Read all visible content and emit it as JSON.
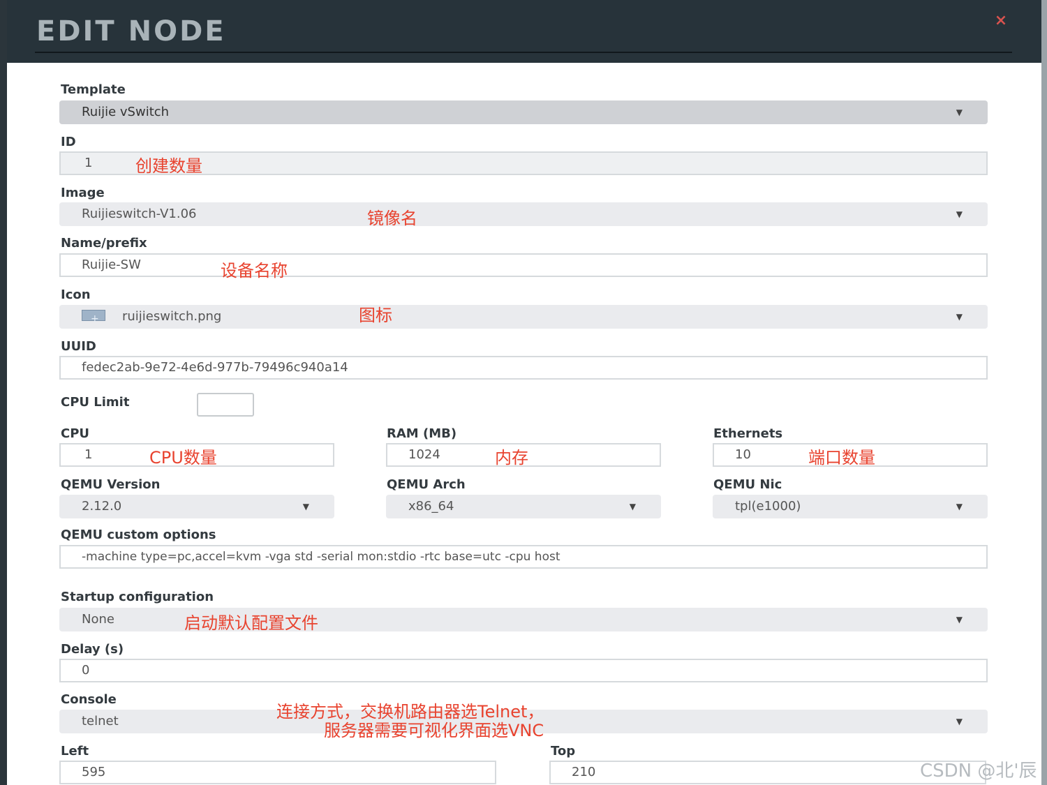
{
  "dialog": {
    "title": "EDIT NODE",
    "close_glyph": "×"
  },
  "form": {
    "template": {
      "label": "Template",
      "value": "Ruijie vSwitch"
    },
    "id": {
      "label": "ID",
      "value": "1"
    },
    "image": {
      "label": "Image",
      "value": "Ruijieswitch-V1.06"
    },
    "name": {
      "label": "Name/prefix",
      "value": "Ruijie-SW"
    },
    "icon": {
      "label": "Icon",
      "value": "ruijieswitch.png",
      "icon_name": "image-file-icon"
    },
    "uuid": {
      "label": "UUID",
      "value": "fedec2ab-9e72-4e6d-977b-79496c940a14"
    },
    "cpu_limit": {
      "label": "CPU Limit",
      "checked": false
    },
    "cpu": {
      "label": "CPU",
      "value": "1"
    },
    "ram": {
      "label": "RAM (MB)",
      "value": "1024"
    },
    "ethernets": {
      "label": "Ethernets",
      "value": "10"
    },
    "qemu_version": {
      "label": "QEMU Version",
      "value": "2.12.0"
    },
    "qemu_arch": {
      "label": "QEMU Arch",
      "value": "x86_64"
    },
    "qemu_nic": {
      "label": "QEMU Nic",
      "value": "tpl(e1000)"
    },
    "qemu_options": {
      "label": "QEMU custom options",
      "value": "-machine type=pc,accel=kvm -vga std -serial mon:stdio -rtc base=utc -cpu host"
    },
    "startup": {
      "label": "Startup configuration",
      "value": "None"
    },
    "delay": {
      "label": "Delay (s)",
      "value": "0"
    },
    "console": {
      "label": "Console",
      "value": "telnet"
    },
    "left": {
      "label": "Left",
      "value": "595"
    },
    "top": {
      "label": "Top",
      "value": "210"
    }
  },
  "annotations": {
    "id_note": "创建数量",
    "image_note": "镜像名",
    "name_note": "设备名称",
    "icon_note": "图标",
    "cpu_note": "CPU数量",
    "ram_note": "内存",
    "eth_note": "端口数量",
    "startup_note": "启动默认配置文件",
    "console_note_1": "连接方式，交换机路由器选Telnet，",
    "console_note_2": "服务器需要可视化界面选VNC"
  },
  "watermark": "CSDN @北'辰",
  "colors": {
    "header": "#27333a",
    "annotation": "#e8432f",
    "close": "#d9534f"
  }
}
